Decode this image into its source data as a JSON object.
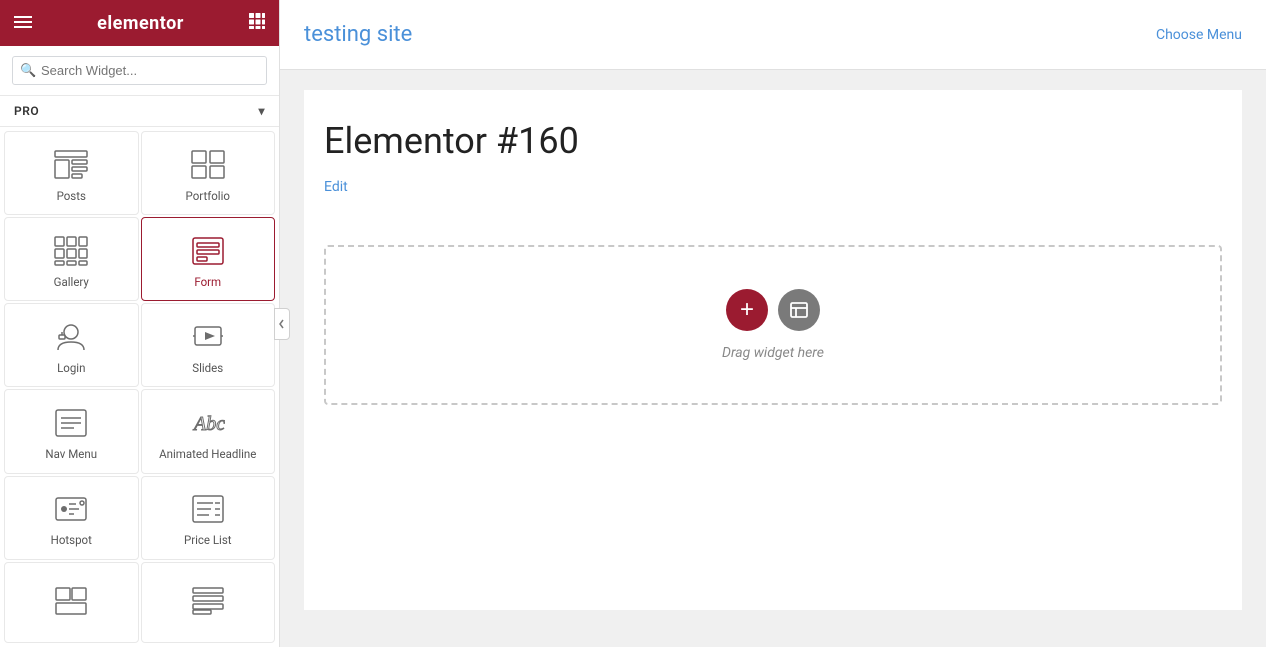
{
  "header": {
    "logo": "elementor",
    "hamburger_icon": "≡",
    "grid_icon": "⊞"
  },
  "search": {
    "placeholder": "Search Widget..."
  },
  "pro_filter": {
    "label": "PRO",
    "chevron": "▾"
  },
  "widgets": [
    {
      "id": "posts",
      "label": "Posts",
      "icon": "posts"
    },
    {
      "id": "portfolio",
      "label": "Portfolio",
      "icon": "portfolio"
    },
    {
      "id": "gallery",
      "label": "Gallery",
      "icon": "gallery"
    },
    {
      "id": "form",
      "label": "Form",
      "icon": "form",
      "active": true
    },
    {
      "id": "login",
      "label": "Login",
      "icon": "login"
    },
    {
      "id": "slides",
      "label": "Slides",
      "icon": "slides"
    },
    {
      "id": "nav-menu",
      "label": "Nav Menu",
      "icon": "nav-menu"
    },
    {
      "id": "animated-headline",
      "label": "Animated Headline",
      "icon": "animated-headline"
    },
    {
      "id": "hotspot",
      "label": "Hotspot",
      "icon": "hotspot"
    },
    {
      "id": "price-list",
      "label": "Price List",
      "icon": "price-list"
    },
    {
      "id": "widget-11",
      "label": "",
      "icon": "generic"
    },
    {
      "id": "widget-12",
      "label": "",
      "icon": "generic2"
    }
  ],
  "main": {
    "site_title": "testing site",
    "choose_menu": "Choose Menu",
    "page_title": "Elementor #160",
    "edit_label": "Edit",
    "drag_label": "Drag widget here"
  }
}
